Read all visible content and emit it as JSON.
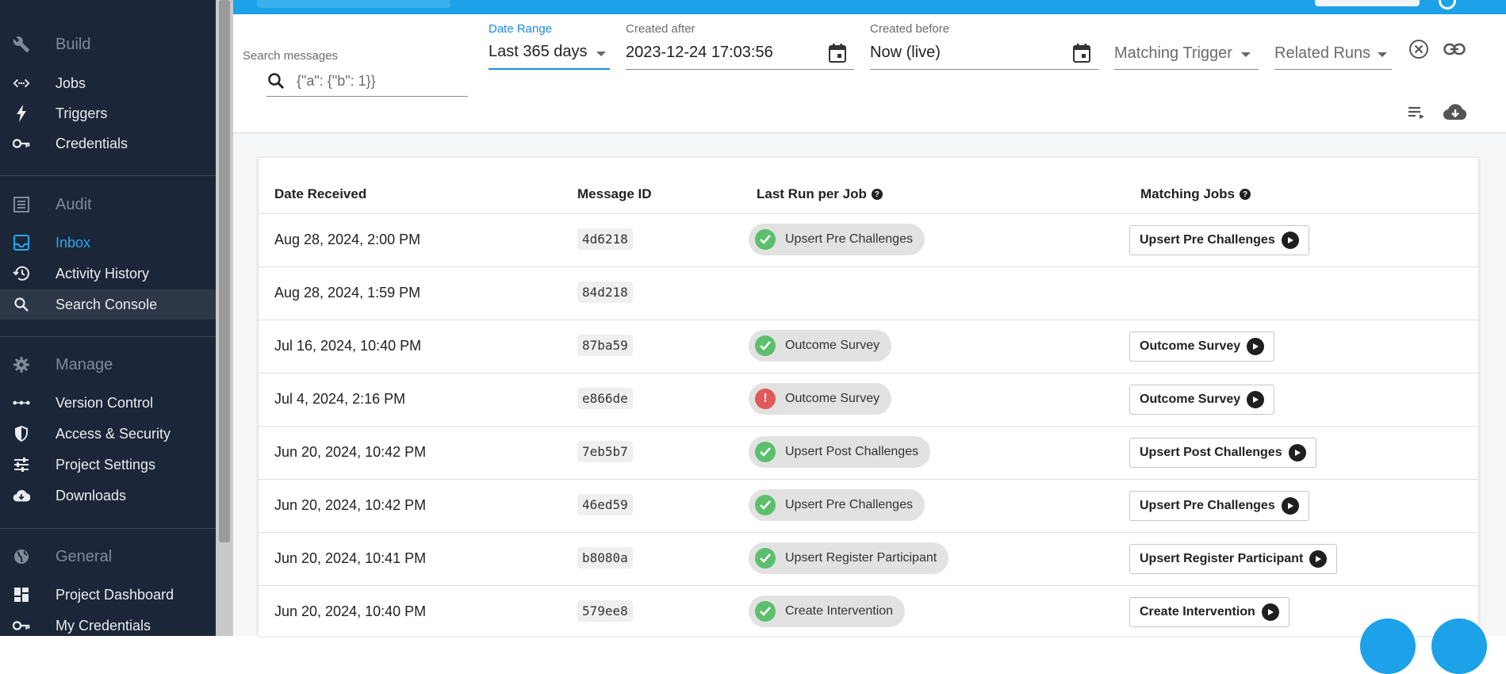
{
  "sidebar": {
    "groups": [
      {
        "label": "Build",
        "icon": "wrench-icon"
      },
      {
        "label": "Audit",
        "icon": "list-icon"
      },
      {
        "label": "Manage",
        "icon": "gear-icon"
      },
      {
        "label": "General",
        "icon": "globe-icon"
      }
    ],
    "build_items": [
      {
        "label": "Jobs",
        "icon": "code-icon"
      },
      {
        "label": "Triggers",
        "icon": "bolt-icon"
      },
      {
        "label": "Credentials",
        "icon": "key-icon"
      }
    ],
    "audit_items": [
      {
        "label": "Inbox",
        "icon": "inbox-icon"
      },
      {
        "label": "Activity History",
        "icon": "history-icon"
      },
      {
        "label": "Search Console",
        "icon": "search-icon"
      }
    ],
    "manage_items": [
      {
        "label": "Version Control",
        "icon": "commit-icon"
      },
      {
        "label": "Access & Security",
        "icon": "shield-icon"
      },
      {
        "label": "Project Settings",
        "icon": "sliders-icon"
      },
      {
        "label": "Downloads",
        "icon": "cloud-download-icon"
      }
    ],
    "general_items": [
      {
        "label": "Project Dashboard",
        "icon": "dashboard-icon"
      },
      {
        "label": "My Credentials",
        "icon": "key-icon"
      }
    ]
  },
  "filters": {
    "search": {
      "label": "Search messages",
      "placeholder": "{\"a\": {\"b\": 1}}"
    },
    "date_range": {
      "label": "Date Range",
      "value": "Last 365 days"
    },
    "created_after": {
      "label": "Created after",
      "value": "2023-12-24 17:03:56"
    },
    "created_before": {
      "label": "Created before",
      "value": "Now (live)"
    },
    "matching_trigger": {
      "label": "Matching Trigger"
    },
    "related_runs": {
      "label": "Related Runs"
    }
  },
  "table": {
    "headers": {
      "date": "Date Received",
      "message_id": "Message ID",
      "last_run": "Last Run per Job",
      "matching_jobs": "Matching Jobs"
    },
    "help_glyph": "?",
    "rows": [
      {
        "date": "Aug 28, 2024, 2:00 PM",
        "id": "4d6218",
        "run": "Upsert Pre Challenges",
        "status": "success",
        "job": "Upsert Pre Challenges"
      },
      {
        "date": "Aug 28, 2024, 1:59 PM",
        "id": "84d218",
        "run": "",
        "status": "",
        "job": ""
      },
      {
        "date": "Jul 16, 2024, 10:40 PM",
        "id": "87ba59",
        "run": "Outcome Survey",
        "status": "success",
        "job": "Outcome Survey"
      },
      {
        "date": "Jul 4, 2024, 2:16 PM",
        "id": "e866de",
        "run": "Outcome Survey",
        "status": "failed",
        "job": "Outcome Survey"
      },
      {
        "date": "Jun 20, 2024, 10:42 PM",
        "id": "7eb5b7",
        "run": "Upsert Post Challenges",
        "status": "success",
        "job": "Upsert Post Challenges"
      },
      {
        "date": "Jun 20, 2024, 10:42 PM",
        "id": "46ed59",
        "run": "Upsert Pre Challenges",
        "status": "success",
        "job": "Upsert Pre Challenges"
      },
      {
        "date": "Jun 20, 2024, 10:41 PM",
        "id": "b8080a",
        "run": "Upsert Register Participant",
        "status": "success",
        "job": "Upsert Register Participant"
      },
      {
        "date": "Jun 20, 2024, 10:40 PM",
        "id": "579ee8",
        "run": "Create Intervention",
        "status": "success",
        "job": "Create Intervention"
      }
    ]
  },
  "colors": {
    "accent": "#1da1e8",
    "sidebar_bg": "#1b2638",
    "success": "#5cbf6c",
    "error": "#e05a5a"
  }
}
